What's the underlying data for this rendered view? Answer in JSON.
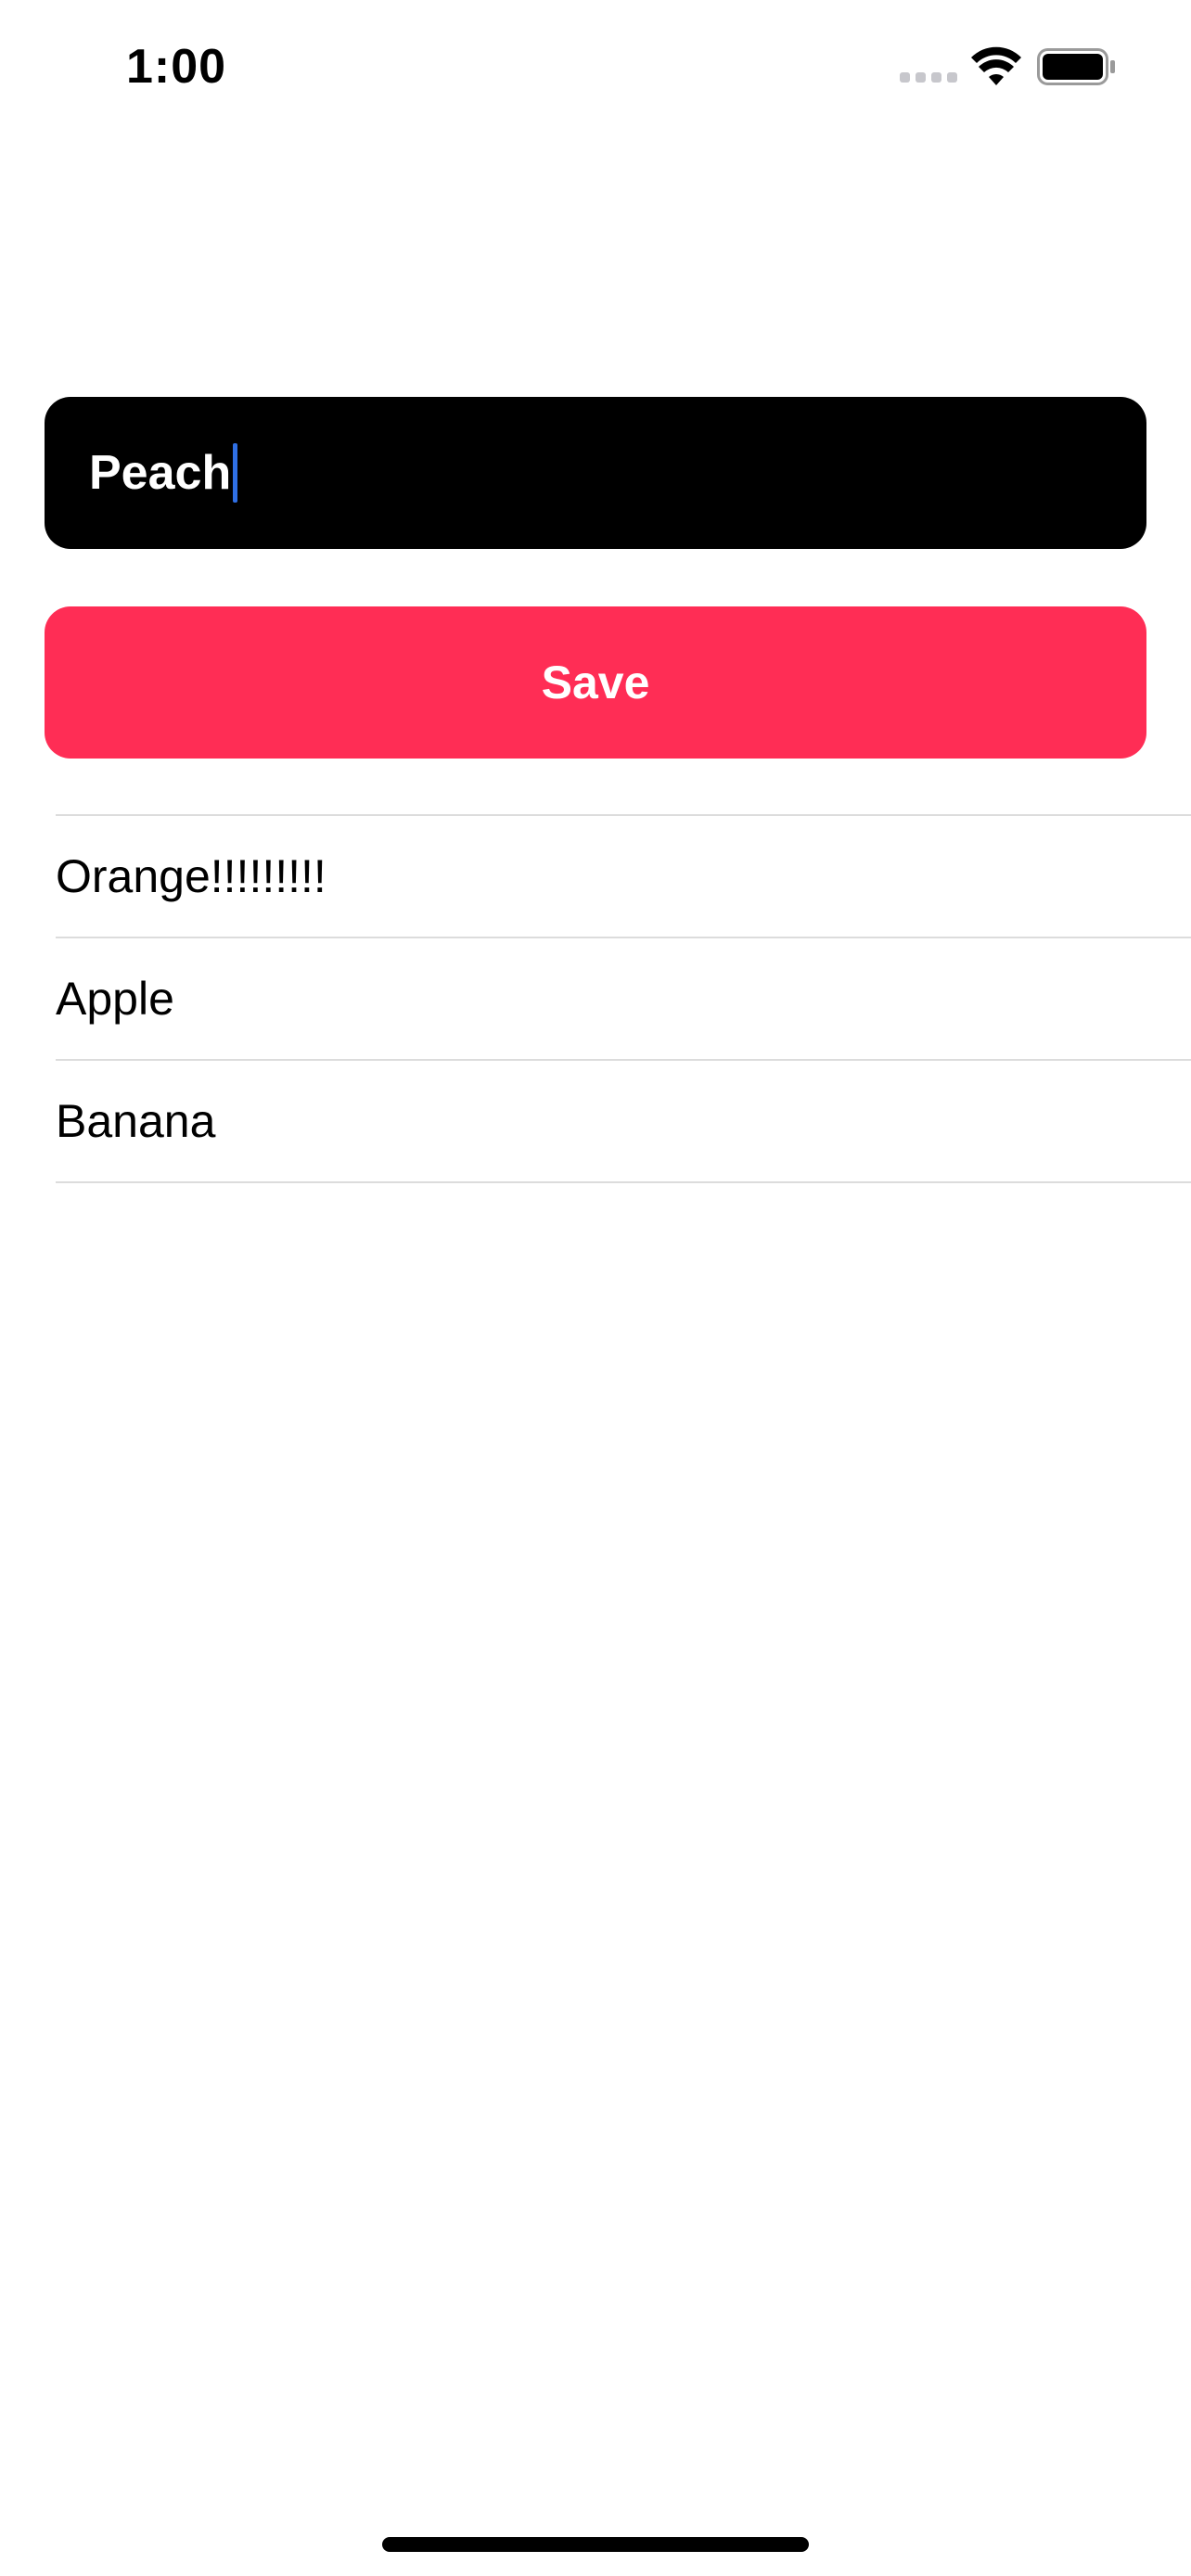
{
  "status_bar": {
    "time": "1:00"
  },
  "form": {
    "input_value": "Peach",
    "save_label": "Save"
  },
  "list": {
    "items": [
      "Orange!!!!!!!!!",
      "Apple",
      "Banana"
    ]
  },
  "colors": {
    "accent": "#ff2d55",
    "field_background": "#000000",
    "cursor": "#2f6fe4",
    "separator": "#dcdcdc"
  },
  "icons": {
    "cellular": "cellular-signal-icon",
    "wifi": "wifi-icon",
    "battery": "battery-icon"
  }
}
